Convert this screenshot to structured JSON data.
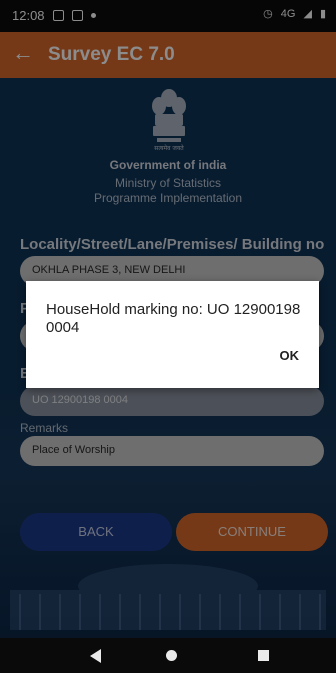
{
  "status_bar": {
    "time": "12:08",
    "lte": "4G"
  },
  "app_bar": {
    "title": "Survey EC 7.0"
  },
  "header": {
    "emblem_caption": "सत्यमेव जयते",
    "line1": "Government of india",
    "line2": "Ministry of Statistics",
    "line3": "Programme Implementation"
  },
  "form": {
    "locality_label": "Locality/Street/Lane/Premises/ Building no",
    "locality_value": "OKHLA PHASE 3, NEW DELHI",
    "hidden_label_1": "P",
    "hidden_label_2": "E",
    "household_value": "UO 12900198 0004",
    "remarks_label": "Remarks",
    "remarks_value": "Place of Worship",
    "back_label": "BACK",
    "continue_label": "CONTINUE"
  },
  "dialog": {
    "message": "HouseHold marking no: UO 12900198 0004",
    "ok_label": "OK"
  },
  "colors": {
    "accent": "#d7692d",
    "background": "#0f3358",
    "back_button": "#1d3a8a"
  }
}
